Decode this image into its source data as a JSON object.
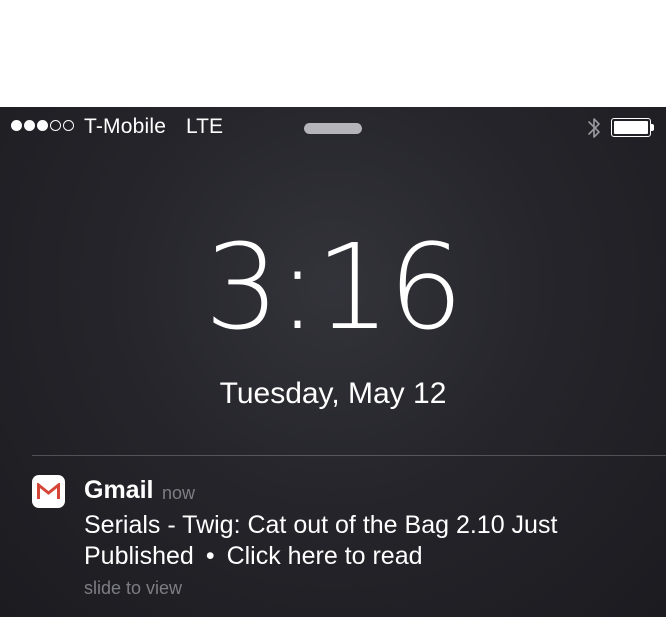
{
  "status_bar": {
    "signal_strength": {
      "filled": 3,
      "total": 5
    },
    "carrier": "T-Mobile",
    "network": "LTE",
    "battery_level": 1.0,
    "icons": [
      "bluetooth-icon",
      "battery-icon"
    ]
  },
  "lock": {
    "time": "3:16",
    "date": "Tuesday, May 12"
  },
  "notification": {
    "app_name": "Gmail",
    "app_icon": "gmail-icon",
    "time": "now",
    "message_line1": "Serials - Twig: Cat out of the Bag 2.10 Just",
    "message_line2a": "Published",
    "bullet": "•",
    "message_line2b": "Click here to read",
    "slide_hint": "slide to view"
  },
  "colors": {
    "background": "#25252b",
    "secondary_text": "#7d7d84",
    "gmail_red": "#d44638"
  }
}
